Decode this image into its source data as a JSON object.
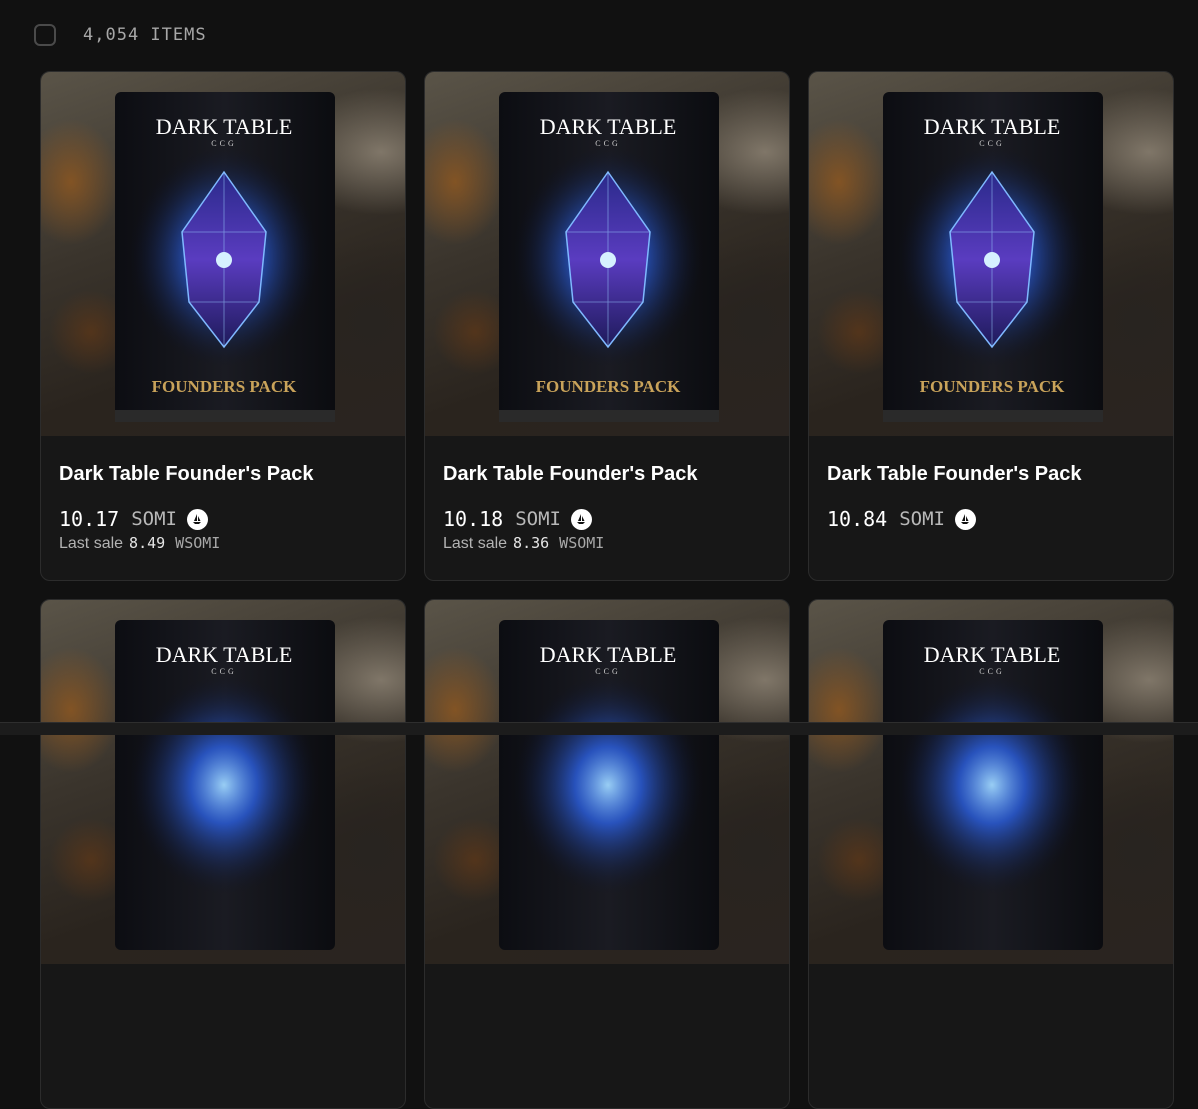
{
  "header": {
    "item_count": "4,054 ITEMS"
  },
  "cards": [
    {
      "brand_top": "DARK TABLE",
      "brand_sub": "CCG",
      "pack_label": "FOUNDERS PACK",
      "title": "Dark Table Founder's Pack",
      "price": "10.17",
      "currency": "SOMI",
      "last_sale_label": "Last sale",
      "last_sale_value": "8.49",
      "last_sale_currency": "WSOMI"
    },
    {
      "brand_top": "DARK TABLE",
      "brand_sub": "CCG",
      "pack_label": "FOUNDERS PACK",
      "title": "Dark Table Founder's Pack",
      "price": "10.18",
      "currency": "SOMI",
      "last_sale_label": "Last sale",
      "last_sale_value": "8.36",
      "last_sale_currency": "WSOMI"
    },
    {
      "brand_top": "DARK TABLE",
      "brand_sub": "CCG",
      "pack_label": "FOUNDERS PACK",
      "title": "Dark Table Founder's Pack",
      "price": "10.84",
      "currency": "SOMI"
    },
    {
      "brand_top": "DARK TABLE",
      "brand_sub": "CCG"
    },
    {
      "brand_top": "DARK TABLE",
      "brand_sub": "CCG"
    },
    {
      "brand_top": "DARK TABLE",
      "brand_sub": "CCG"
    }
  ],
  "icons": {
    "token": "somi-token-icon",
    "checkbox": "select-all-checkbox"
  },
  "colors": {
    "background": "#111111",
    "card": "#171717",
    "pack_gold": "#c9a35a",
    "crystal": "#3b6cff"
  }
}
